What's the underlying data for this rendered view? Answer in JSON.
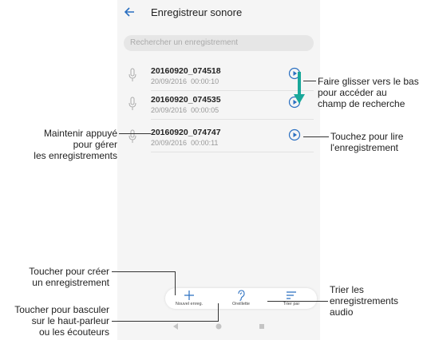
{
  "app": {
    "title": "Enregistreur sonore"
  },
  "search": {
    "placeholder": "Rechercher un enregistrement"
  },
  "recordings": [
    {
      "name": "20160920_074518",
      "date": "20/09/2016",
      "duration": "00:00:10"
    },
    {
      "name": "20160920_074535",
      "date": "20/09/2016",
      "duration": "00:00:05"
    },
    {
      "name": "20160920_074747",
      "date": "20/09/2016",
      "duration": "00:00:11"
    }
  ],
  "bottom_bar": {
    "new_label": "Nouvel enreg.",
    "earpiece_label": "Oreillette",
    "sort_label": "Trier par"
  },
  "annotations": {
    "swipe": [
      "Faire glisser vers le bas",
      "pour accéder au",
      "champ de recherche"
    ],
    "hold": [
      "Maintenir appuyé",
      "pour gérer",
      "les enregistrements"
    ],
    "play": [
      "Touchez pour lire",
      "l'enregistrement"
    ],
    "create": [
      "Toucher pour créer",
      "un enregistrement"
    ],
    "sort": [
      "Trier les",
      "enregistrements",
      "audio"
    ],
    "switch": [
      "Toucher pour basculer",
      "sur le haut-parleur",
      "ou les écouteurs"
    ]
  },
  "colors": {
    "accent": "#2a6fc1",
    "arrow": "#1aa89a"
  }
}
